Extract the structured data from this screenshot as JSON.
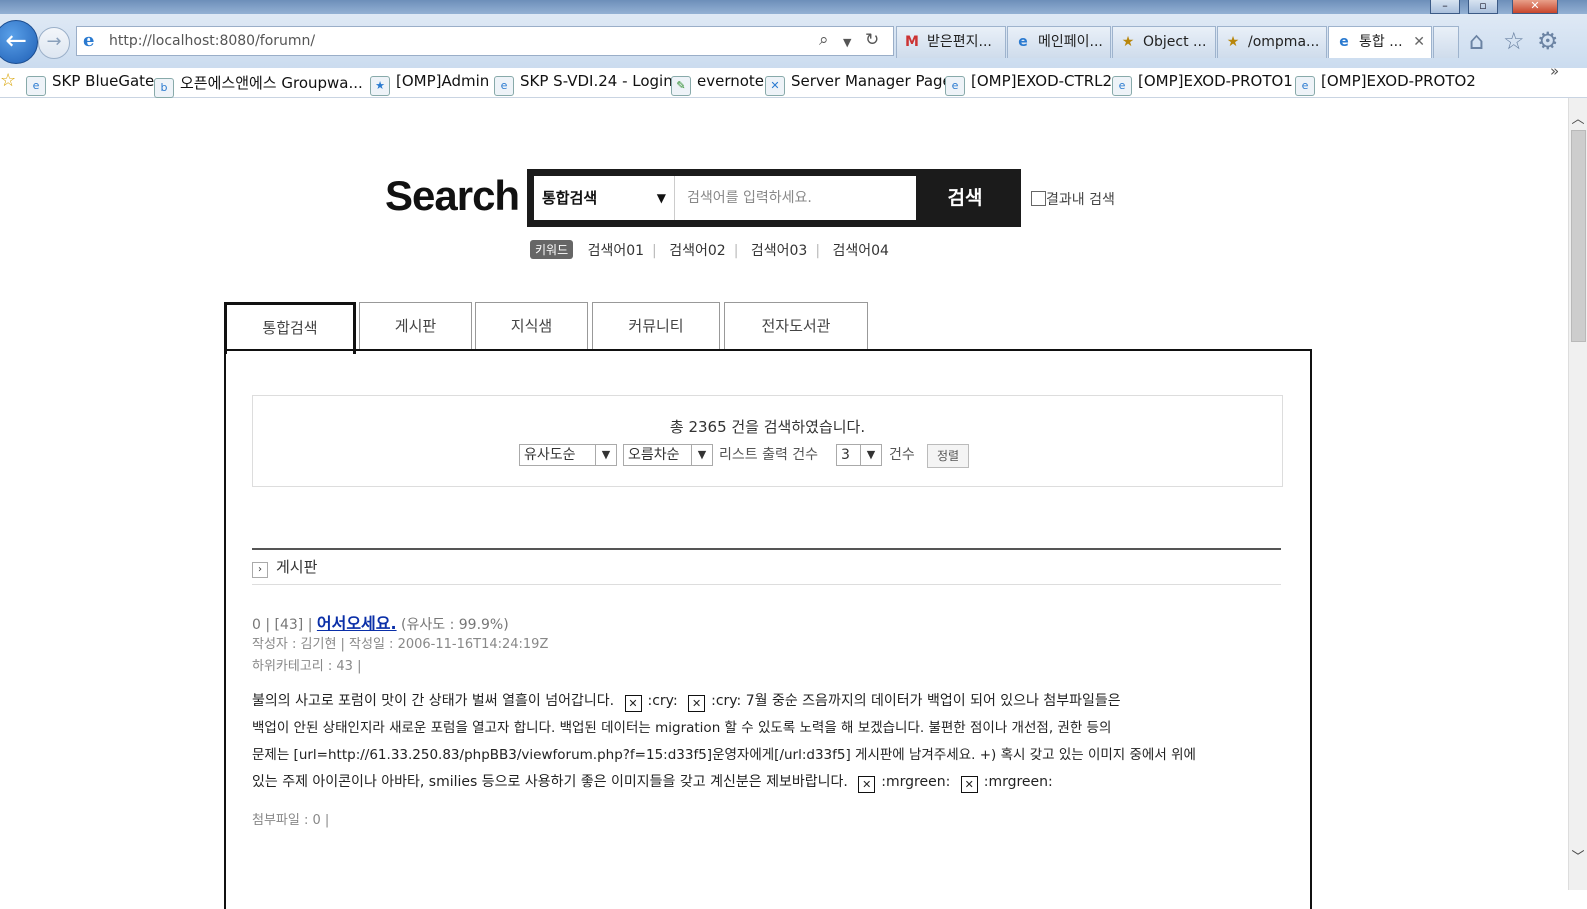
{
  "browser": {
    "url": "http://localhost:8080/forumn/",
    "tabs": [
      {
        "label": "받은편지...",
        "icon": "M"
      },
      {
        "label": "메인페이...",
        "icon": "e"
      },
      {
        "label": "Object ...",
        "icon": "★"
      },
      {
        "label": "/ompma...",
        "icon": "★"
      },
      {
        "label": "통합 ...",
        "icon": "e"
      }
    ],
    "favorites": [
      "SKP BlueGate",
      "오픈에스앤에스 Groupwa...",
      "[OMP]Admin",
      "SKP S-VDI.24 - Login",
      "evernote",
      "Server Manager Page",
      "[OMP]EXOD-CTRL2",
      "[OMP]EXOD-PROTO1",
      "[OMP]EXOD-PROTO2"
    ]
  },
  "page": {
    "logo": "Search",
    "search": {
      "scope_selected": "통합검색",
      "placeholder": "검색어를 입력하세요.",
      "button": "검색",
      "within_label": "결과내 검색"
    },
    "keywords": {
      "badge": "키워드",
      "items": [
        "검색어01",
        "검색어02",
        "검색어03",
        "검색어04"
      ]
    },
    "tabs": [
      "통합검색",
      "게시판",
      "지식샘",
      "커뮤니티",
      "전자도서관"
    ],
    "summary": {
      "total_text": "총 2365 건을 검색하였습니다.",
      "sort_by": "유사도순",
      "order": "오름차순",
      "list_label": "리스트 출력 건수",
      "count": "3",
      "count_unit": "건수",
      "sort_button": "정렬"
    },
    "section": {
      "title": "게시판",
      "result": {
        "prefix": "0 | [43] |",
        "title": "어서오세요.",
        "similarity": "(유사도 : 99.9%)",
        "author": "작성자 : 김기현 |  작성일 : 2006-11-16T14:24:19Z",
        "category": "하위카테고리 : 43 |",
        "line1a": "불의의 사고로 포럼이 맛이 간 상태가 벌써 열흘이 넘어갑니다.",
        "cry1": ":cry:",
        "cry2": ":cry:",
        "line1b": "7월 중순 즈음까지의 데이터가 백업이 되어 있으나 첨부파일들은",
        "line2": "백업이 안된 상태인지라 새로운 포럼을 열고자 합니다. 백업된 데이터는 migration 할 수 있도록 노력을 해 보겠습니다. 불편한 점이나 개선점, 권한 등의",
        "line3": "문제는 [url=http://61.33.250.83/phpBB3/viewforum.php?f=15:d33f5]운영자에게[/url:d33f5] 게시판에 남겨주세요. +) 혹시 갖고 있는 이미지 중에서 위에",
        "line4": "있는 주제 아이콘이나 아바타, smilies 등으로 사용하기 좋은 이미지들을 갖고 계신분은 제보바랍니다.",
        "mr1": ":mrgreen:",
        "mr2": ":mrgreen:",
        "attach": "첨부파일 : 0 |"
      }
    }
  }
}
